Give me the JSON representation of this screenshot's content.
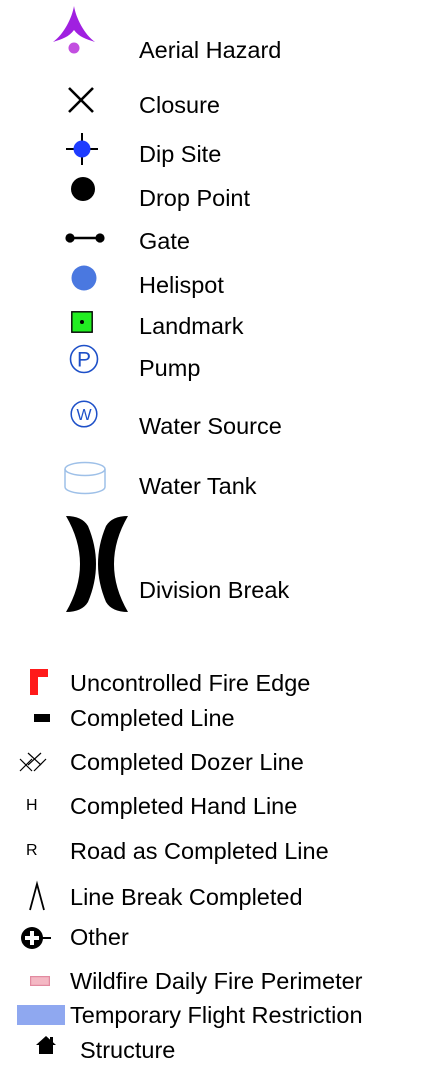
{
  "legend": {
    "point_symbols": [
      {
        "label": "Aerial Hazard",
        "icon": "aerial-hazard-icon",
        "color": "#a020e0"
      },
      {
        "label": "Closure",
        "icon": "closure-x-icon",
        "color": "#000000"
      },
      {
        "label": "Dip Site",
        "icon": "dip-site-crosshair-icon",
        "color": "#1e3cff"
      },
      {
        "label": "Drop Point",
        "icon": "drop-point-dot-icon",
        "color": "#000000"
      },
      {
        "label": "Gate",
        "icon": "gate-icon",
        "color": "#000000"
      },
      {
        "label": "Helispot",
        "icon": "helispot-dot-icon",
        "color": "#4a78e0"
      },
      {
        "label": "Landmark",
        "icon": "landmark-square-icon",
        "color": "#22ee22"
      },
      {
        "label": "Pump",
        "icon": "pump-circle-p-icon",
        "color": "#1e50c8"
      },
      {
        "label": "Water Source",
        "icon": "water-source-circle-w-icon",
        "color": "#1e50c8"
      },
      {
        "label": "Water Tank",
        "icon": "water-tank-cylinder-icon",
        "color": "#9ec0e8"
      },
      {
        "label": "Division Break",
        "icon": "division-break-brackets-icon",
        "color": "#000000"
      }
    ],
    "line_symbols": [
      {
        "label": "Uncontrolled Fire Edge",
        "icon": "uncontrolled-fire-edge-icon",
        "color": "#ff1a1a"
      },
      {
        "label": "Completed Line",
        "icon": "completed-line-dash-icon",
        "color": "#000000"
      },
      {
        "label": "Completed Dozer Line",
        "icon": "dozer-line-xx-icon",
        "color": "#000000"
      },
      {
        "label": "Completed Hand Line",
        "icon": "hand-line-h-icon",
        "glyph": "H",
        "color": "#000000"
      },
      {
        "label": "Road as Completed Line",
        "icon": "road-line-r-icon",
        "glyph": "R",
        "color": "#000000"
      },
      {
        "label": "Line Break Completed",
        "icon": "line-break-caret-icon",
        "color": "#000000"
      },
      {
        "label": "Other",
        "icon": "other-circle-plus-icon",
        "color": "#000000"
      },
      {
        "label": "Wildfire Daily Fire Perimeter",
        "icon": "fire-perimeter-swatch-icon",
        "color": "#f4b8c4"
      },
      {
        "label": "Temporary Flight Restriction",
        "icon": "tfr-swatch-icon",
        "color": "#8fa8f0"
      },
      {
        "label": "Structure",
        "icon": "structure-house-icon",
        "color": "#000000"
      }
    ]
  }
}
